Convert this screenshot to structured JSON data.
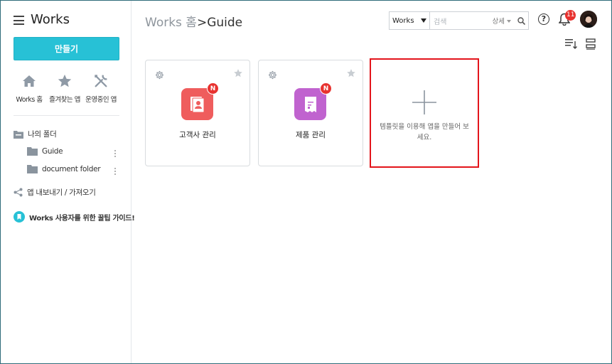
{
  "sidebar": {
    "title": "Works",
    "create_label": "만들기",
    "shortcuts": [
      {
        "label": "Works 홈",
        "icon": "home-icon"
      },
      {
        "label": "즐겨찾는 앱",
        "icon": "star-icon"
      },
      {
        "label": "운영중인 앱",
        "icon": "tools-icon"
      }
    ],
    "my_folder": "나의 폴더",
    "folders": [
      {
        "label": "Guide"
      },
      {
        "label": "document folder"
      }
    ],
    "export_import": "앱 내보내기 / 가져오기",
    "guide_link": "Works 사용자를 위한 꿀팁 가이드!"
  },
  "header": {
    "breadcrumb_home": "Works 홈",
    "breadcrumb_sep": ">",
    "breadcrumb_current": "Guide",
    "search_scope": "Works",
    "search_placeholder": "검색",
    "search_advanced": "상세",
    "help_label": "?",
    "notification_count": "11"
  },
  "apps": [
    {
      "name": "고객사 관리",
      "badge": "N",
      "color": "#ef5d5d"
    },
    {
      "name": "제품 관리",
      "badge": "N",
      "color": "#c063cf"
    }
  ],
  "add_card": {
    "message": "템플릿을 이용해 앱을 만들어 보세요."
  },
  "colors": {
    "accent": "#27c1d6",
    "highlight": "#e3141b",
    "badge": "#e8322f"
  }
}
